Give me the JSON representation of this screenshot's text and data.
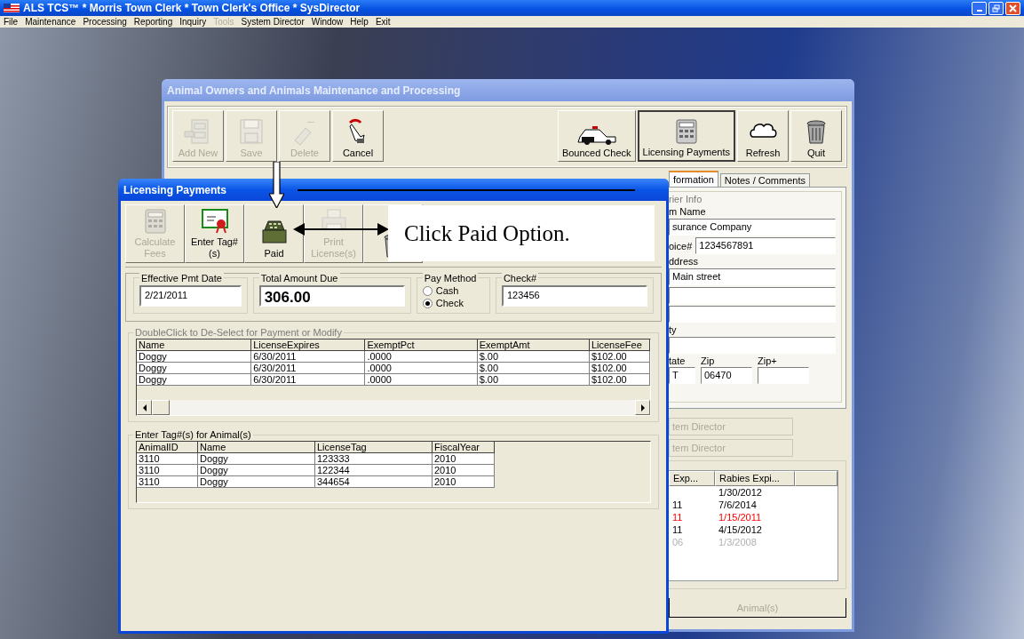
{
  "app": {
    "title": "ALS TCS™ * Morris Town Clerk * Town Clerk's Office * SysDirector",
    "menu": [
      {
        "label": "File",
        "disabled": false
      },
      {
        "label": "Maintenance",
        "disabled": false
      },
      {
        "label": "Processing",
        "disabled": false
      },
      {
        "label": "Reporting",
        "disabled": false
      },
      {
        "label": "Inquiry",
        "disabled": false
      },
      {
        "label": "Tools",
        "disabled": true
      },
      {
        "label": "System Director",
        "disabled": false
      },
      {
        "label": "Window",
        "disabled": false
      },
      {
        "label": "Help",
        "disabled": false
      },
      {
        "label": "Exit",
        "disabled": false
      }
    ]
  },
  "owner_window": {
    "title": "Animal Owners and Animals Maintenance and Processing",
    "toolbar_left": [
      {
        "label": "Add New",
        "kind": "cabinet",
        "disabled": true
      },
      {
        "label": "Save",
        "kind": "disk",
        "disabled": true
      },
      {
        "label": "Delete",
        "kind": "eraser",
        "disabled": true
      },
      {
        "label": "Cancel",
        "kind": "hand",
        "disabled": false
      }
    ],
    "toolbar_right": [
      {
        "label": "Bounced Check",
        "kind": "car",
        "pressed": false
      },
      {
        "label": "Licensing Payments",
        "kind": "calculator",
        "pressed": true
      },
      {
        "label": "Refresh",
        "kind": "cloud",
        "pressed": false
      },
      {
        "label": "Quit",
        "kind": "trash",
        "pressed": false
      }
    ],
    "tabs": [
      {
        "label": "formation",
        "selected": true
      },
      {
        "label": "Notes / Comments",
        "selected": false
      }
    ],
    "carrier": {
      "legend": "rier Info",
      "name_label": "m Name",
      "name_value": "surance Company",
      "invoice_label": "oice#",
      "invoice_value": "1234567891",
      "address_label": "ddress",
      "address_value": "Main street",
      "city_label": "ty",
      "state_label": "tate",
      "zip_label": "Zip",
      "zip_plus_label": "Zip+",
      "state_value": "T",
      "zip_value": "06470"
    },
    "director_buttons": [
      {
        "label": "tem Director",
        "disabled": true
      },
      {
        "label": "tem Director",
        "disabled": true
      }
    ],
    "animal_list": {
      "columns": [
        "Exp...",
        "Rabies Expi..."
      ],
      "rows": [
        {
          "rabies": "1/30/2012",
          "color": "#000000"
        },
        {
          "exp": "11",
          "rabies": "7/6/2014",
          "color": "#000000"
        },
        {
          "exp": "11",
          "rabies": "1/15/2011",
          "color": "#ff0000"
        },
        {
          "exp": "11",
          "rabies": "4/15/2012",
          "color": "#000000"
        },
        {
          "exp": "06",
          "rabies": "1/3/2008",
          "color": "#b0b0b0"
        }
      ]
    },
    "bottom_tab": {
      "label": "Animal(s)",
      "disabled": true
    }
  },
  "payments_window": {
    "title": "Licensing Payments",
    "toolbar": [
      {
        "label": "Calculate Fees",
        "kind": "calculator",
        "disabled": true
      },
      {
        "label": "Enter Tag#(s)",
        "kind": "certificate",
        "disabled": false
      },
      {
        "label": "Paid",
        "kind": "register",
        "disabled": false
      },
      {
        "label": "Print License(s)",
        "kind": "printer",
        "disabled": true
      },
      {
        "kind": "trash"
      }
    ],
    "effective_date": {
      "label": "Effective Pmt Date",
      "value": "2/21/2011"
    },
    "total": {
      "label": "Total Amount Due",
      "value": "306.00"
    },
    "pay_method": {
      "label": "Pay Method",
      "options": [
        {
          "label": "Cash",
          "selected": false
        },
        {
          "label": "Check",
          "selected": true
        }
      ]
    },
    "check_no": {
      "label": "Check#",
      "value": "123456"
    },
    "fees_grid": {
      "legend": "DoubleClick to De-Select for Payment or Modify",
      "columns": [
        "Name",
        "LicenseExpires",
        "ExemptPct",
        "ExemptAmt",
        "LicenseFee"
      ],
      "rows": [
        [
          "Doggy",
          "6/30/2011",
          ".0000",
          "$.00",
          "$102.00"
        ],
        [
          "Doggy",
          "6/30/2011",
          ".0000",
          "$.00",
          "$102.00"
        ],
        [
          "Doggy",
          "6/30/2011",
          ".0000",
          "$.00",
          "$102.00"
        ]
      ]
    },
    "tags_grid": {
      "legend": "Enter Tag#(s) for Animal(s)",
      "columns": [
        "AnimalID",
        "Name",
        "LicenseTag",
        "FiscalYear"
      ],
      "rows": [
        [
          "3110",
          "Doggy",
          "123333",
          "2010"
        ],
        [
          "3110",
          "Doggy",
          "122344",
          "2010"
        ],
        [
          "3110",
          "Doggy",
          "344654",
          "2010"
        ]
      ]
    }
  },
  "annotation": {
    "text": "Click Paid Option."
  }
}
